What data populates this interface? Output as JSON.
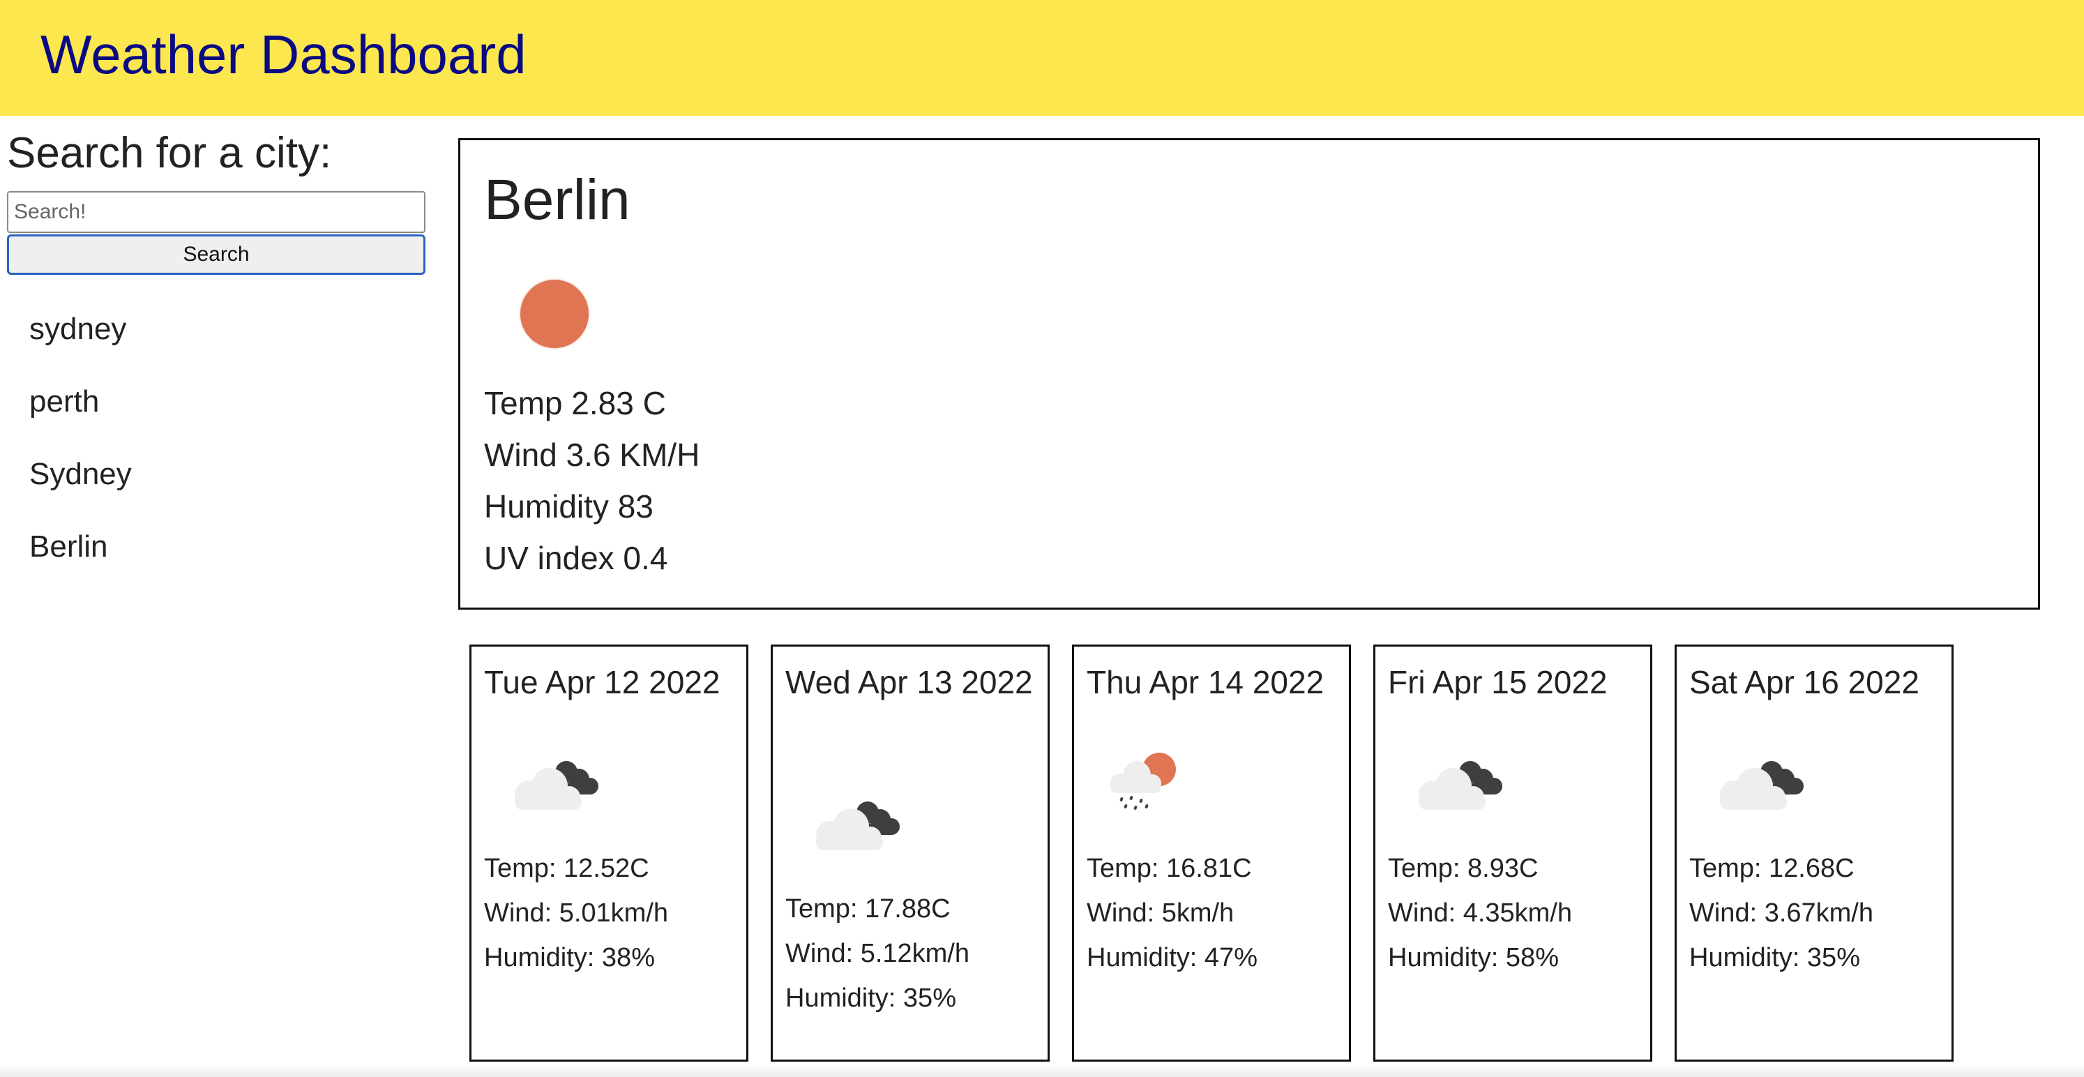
{
  "header": {
    "title": "Weather Dashboard",
    "background_color": "#fce74f",
    "title_color": "#0a0a82"
  },
  "sidebar": {
    "heading": "Search for a city:",
    "search_placeholder": "Search!",
    "search_value": "",
    "search_button_label": "Search",
    "history": [
      {
        "label": "sydney"
      },
      {
        "label": "perth"
      },
      {
        "label": "Sydney"
      },
      {
        "label": "Berlin"
      }
    ]
  },
  "current": {
    "city": "Berlin",
    "icon": "sun-icon",
    "temp": "Temp 2.83 C",
    "wind": "Wind 3.6 KM/H",
    "humidity": "Humidity 83",
    "uv": "UV index 0.4",
    "sun_color": "#e07553"
  },
  "forecast": [
    {
      "date": "Tue Apr 12 2022",
      "icon": "broken-clouds-icon",
      "temp": "Temp: 12.52C",
      "wind": "Wind: 5.01km/h",
      "humidity": "Humidity: 38%"
    },
    {
      "date": "Wed Apr 13 2022",
      "icon": "broken-clouds-icon",
      "temp": "Temp: 17.88C",
      "wind": "Wind: 5.12km/h",
      "humidity": "Humidity: 35%"
    },
    {
      "date": "Thu Apr 14 2022",
      "icon": "rain-sun-icon",
      "temp": "Temp: 16.81C",
      "wind": "Wind: 5km/h",
      "humidity": "Humidity: 47%"
    },
    {
      "date": "Fri Apr 15 2022",
      "icon": "broken-clouds-icon",
      "temp": "Temp: 8.93C",
      "wind": "Wind: 4.35km/h",
      "humidity": "Humidity: 58%"
    },
    {
      "date": "Sat Apr 16 2022",
      "icon": "broken-clouds-icon",
      "temp": "Temp: 12.68C",
      "wind": "Wind: 3.67km/h",
      "humidity": "Humidity: 35%"
    }
  ]
}
